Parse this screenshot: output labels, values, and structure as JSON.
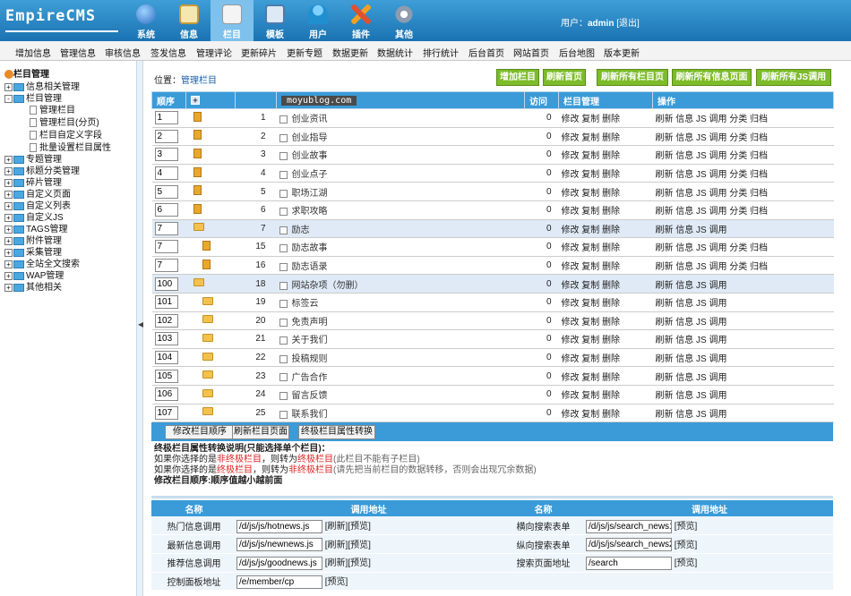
{
  "logo": "EmpireCMS",
  "nav": [
    {
      "label": "系统",
      "icon": "globe-icon",
      "color": "#3a78c8"
    },
    {
      "label": "信息",
      "icon": "note-icon",
      "color": "#e0b050"
    },
    {
      "label": "栏目",
      "icon": "folder-icon",
      "color": "#e8e8e8"
    },
    {
      "label": "模板",
      "icon": "window-icon",
      "color": "#6aa0d0"
    },
    {
      "label": "用户",
      "icon": "user-icon",
      "color": "#30a0d8"
    },
    {
      "label": "插件",
      "icon": "tools-icon",
      "color": "#e05030"
    },
    {
      "label": "其他",
      "icon": "gear-icon",
      "color": "#9aa8b8"
    }
  ],
  "user": {
    "prefix": "用户：",
    "name": "admin",
    "logout": "[退出]"
  },
  "subnav": [
    "增加信息",
    "管理信息",
    "审核信息",
    "签发信息",
    "管理评论",
    "更新碎片",
    "更新专题",
    "数据更新",
    "数据统计",
    "排行统计",
    "后台首页",
    "网站首页",
    "后台地图",
    "版本更新"
  ],
  "sidebar": {
    "root": "栏目管理",
    "items": [
      "信息相关管理",
      "栏目管理",
      "管理栏目",
      "管理栏目(分页)",
      "栏目自定义字段",
      "批量设置栏目属性",
      "专题管理",
      "标题分类管理",
      "碎片管理",
      "自定义页面",
      "自定义列表",
      "自定义JS",
      "TAGS管理",
      "附件管理",
      "采集管理",
      "全站全文搜索",
      "WAP管理",
      "其他相关"
    ]
  },
  "location": {
    "label": "位置：",
    "link": "管理栏目"
  },
  "buttons": [
    "增加栏目",
    "刷新首页",
    "刷新所有栏目页",
    "刷新所有信息页面",
    "刷新所有JS调用"
  ],
  "table": {
    "headers": [
      "顺序",
      "",
      "",
      "访问",
      "栏目管理",
      "操作"
    ],
    "watermark": "moyublog.com",
    "rows": [
      {
        "order": "1",
        "icon": "page",
        "id": "1",
        "name": "创业资讯",
        "visits": "0",
        "manage": "修改 复制 删除",
        "ops": "刷新 信息 JS 调用 分类 归档",
        "indent": 0
      },
      {
        "order": "2",
        "icon": "page",
        "id": "2",
        "name": "创业指导",
        "visits": "0",
        "manage": "修改 复制 删除",
        "ops": "刷新 信息 JS 调用 分类 归档",
        "indent": 0
      },
      {
        "order": "3",
        "icon": "page",
        "id": "3",
        "name": "创业故事",
        "visits": "0",
        "manage": "修改 复制 删除",
        "ops": "刷新 信息 JS 调用 分类 归档",
        "indent": 0
      },
      {
        "order": "4",
        "icon": "page",
        "id": "4",
        "name": "创业点子",
        "visits": "0",
        "manage": "修改 复制 删除",
        "ops": "刷新 信息 JS 调用 分类 归档",
        "indent": 0
      },
      {
        "order": "5",
        "icon": "page",
        "id": "5",
        "name": "职场江湖",
        "visits": "0",
        "manage": "修改 复制 删除",
        "ops": "刷新 信息 JS 调用 分类 归档",
        "indent": 0
      },
      {
        "order": "6",
        "icon": "page",
        "id": "6",
        "name": "求职攻略",
        "visits": "0",
        "manage": "修改 复制 删除",
        "ops": "刷新 信息 JS 调用 分类 归档",
        "indent": 0
      },
      {
        "order": "7",
        "icon": "folder",
        "id": "7",
        "name": "励志",
        "visits": "0",
        "manage": "修改 复制 删除",
        "ops": "刷新 信息 JS 调用",
        "indent": 0,
        "hl": true
      },
      {
        "order": "7",
        "icon": "page",
        "id": "15",
        "name": "励志故事",
        "visits": "0",
        "manage": "修改 复制 删除",
        "ops": "刷新 信息 JS 调用 分类 归档",
        "indent": 1
      },
      {
        "order": "7",
        "icon": "page",
        "id": "16",
        "name": "励志语录",
        "visits": "0",
        "manage": "修改 复制 删除",
        "ops": "刷新 信息 JS 调用 分类 归档",
        "indent": 1
      },
      {
        "order": "100",
        "icon": "folder",
        "id": "18",
        "name": "网站杂项（勿删）",
        "visits": "0",
        "manage": "修改 复制 删除",
        "ops": "刷新 信息 JS 调用",
        "indent": 0,
        "hl": true
      },
      {
        "order": "101",
        "icon": "folder",
        "id": "19",
        "name": "标签云",
        "visits": "0",
        "manage": "修改 复制 删除",
        "ops": "刷新 信息 JS 调用",
        "indent": 1
      },
      {
        "order": "102",
        "icon": "folder",
        "id": "20",
        "name": "免责声明",
        "visits": "0",
        "manage": "修改 复制 删除",
        "ops": "刷新 信息 JS 调用",
        "indent": 1
      },
      {
        "order": "103",
        "icon": "folder",
        "id": "21",
        "name": "关于我们",
        "visits": "0",
        "manage": "修改 复制 删除",
        "ops": "刷新 信息 JS 调用",
        "indent": 1
      },
      {
        "order": "104",
        "icon": "folder",
        "id": "22",
        "name": "投稿规则",
        "visits": "0",
        "manage": "修改 复制 删除",
        "ops": "刷新 信息 JS 调用",
        "indent": 1
      },
      {
        "order": "105",
        "icon": "folder",
        "id": "23",
        "name": "广告合作",
        "visits": "0",
        "manage": "修改 复制 删除",
        "ops": "刷新 信息 JS 调用",
        "indent": 1
      },
      {
        "order": "106",
        "icon": "folder",
        "id": "24",
        "name": "留言反馈",
        "visits": "0",
        "manage": "修改 复制 删除",
        "ops": "刷新 信息 JS 调用",
        "indent": 1
      },
      {
        "order": "107",
        "icon": "folder",
        "id": "25",
        "name": "联系我们",
        "visits": "0",
        "manage": "修改 复制 删除",
        "ops": "刷新 信息 JS 调用",
        "indent": 1
      }
    ]
  },
  "bottom_buttons": [
    "修改栏目顺序",
    "刷新栏目页面",
    "终极栏目属性转换"
  ],
  "notes": {
    "title": "终极栏目属性转换说明(只能选择单个栏目)：",
    "l1a": "如果你选择的是",
    "l1b": "非终极栏目",
    "l1c": "，则转为",
    "l1d": "终极栏目",
    "l1e": "(此栏目不能有子栏目)",
    "l2a": "如果你选择的是",
    "l2b": "终极栏目",
    "l2c": "，则转为",
    "l2d": "非终极栏目",
    "l2e": "(请先把当前栏目的数据转移，否则会出现冗余数据)",
    "l3": "修改栏目顺序:顺序值越小越前面"
  },
  "calls": {
    "headers": [
      "名称",
      "调用地址",
      "名称",
      "调用地址"
    ],
    "rows": [
      {
        "n1": "热门信息调用",
        "v1": "/d/js/js/hotnews.js",
        "a1": "[刷新][预览]",
        "n2": "横向搜索表单",
        "v2": "/d/js/js/search_news1",
        "a2": "[预览]"
      },
      {
        "n1": "最新信息调用",
        "v1": "/d/js/js/newnews.js",
        "a1": "[刷新][预览]",
        "n2": "纵向搜索表单",
        "v2": "/d/js/js/search_news2",
        "a2": "[预览]"
      },
      {
        "n1": "推荐信息调用",
        "v1": "/d/js/js/goodnews.js",
        "a1": "[刷新][预览]",
        "n2": "搜索页面地址",
        "v2": "/search",
        "a2": "[预览]"
      },
      {
        "n1": "控制面板地址",
        "v1": "/e/member/cp",
        "a1": "[预览]",
        "n2": "",
        "v2": "",
        "a2": ""
      }
    ]
  }
}
